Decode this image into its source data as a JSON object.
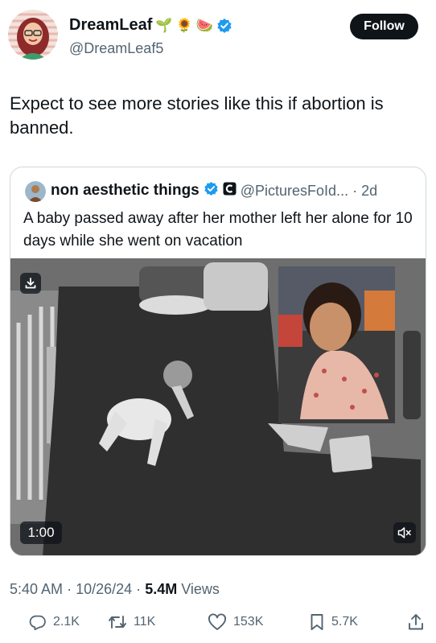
{
  "author": {
    "display_name": "DreamLeaf",
    "name_emojis": [
      "🌱",
      "🌻",
      "🍉"
    ],
    "handle": "@DreamLeaf5",
    "verified": true
  },
  "follow_label": "Follow",
  "tweet_text": "Expect to see more stories like this if abortion is banned.",
  "quoted": {
    "display_name": "non aesthetic things",
    "handle": "@PicturesFoId...",
    "separator": "·",
    "time": "2d",
    "text": "A baby passed away after her mother left her alone for 10 days while she went on vacation",
    "video_duration": "1:00"
  },
  "meta": {
    "time": "5:40 AM",
    "dot1": "·",
    "date": "10/26/24",
    "dot2": "·",
    "views_count": "5.4M",
    "views_label": "Views"
  },
  "actions": {
    "replies": "2.1K",
    "reposts": "11K",
    "likes": "153K",
    "bookmarks": "5.7K"
  },
  "colors": {
    "text": "#0f1419",
    "secondary": "#536471",
    "verified": "#1d9bf0",
    "border": "#cfd9de"
  }
}
